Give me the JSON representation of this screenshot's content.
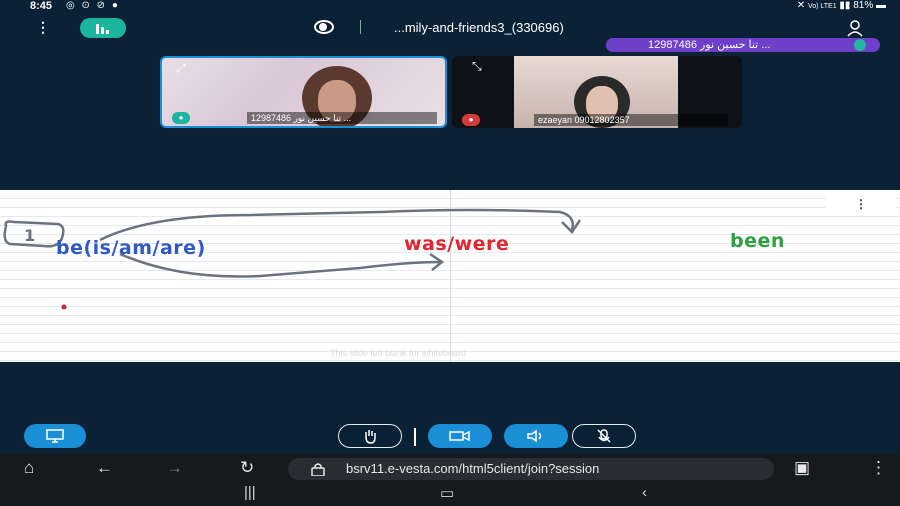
{
  "status": {
    "time": "8:45",
    "left_icons": "◎ ⊙ ⊘ ●",
    "net_label": "Vo)\nLTE1",
    "battery": "81%"
  },
  "header": {
    "meeting_title": "...mily-and-friends3_(330696)"
  },
  "talking": {
    "label": "تنا حسین نور 12987486 ..."
  },
  "videos": [
    {
      "name": "تنا حسین نور 12987486 ...",
      "mic_state": "on"
    },
    {
      "name": "ezaeyan 09012802357",
      "mic_state": "muted"
    }
  ],
  "whiteboard": {
    "number": "1",
    "word1": "be(is/am/are)",
    "word2": "was/were",
    "word3": "been",
    "blank_note": "This slide left blank for whiteboard",
    "menu_icon": "⋮"
  },
  "browser": {
    "url": "bsrv11.e-vesta.com/html5client/join?session"
  },
  "colors": {
    "bg": "#0b2236",
    "accent_teal": "#19b59f",
    "accent_blue": "#1a8fd6",
    "talk_pill": "#6e3fc9",
    "word_blue": "#2f58c9",
    "word_red": "#e0262e",
    "word_green": "#2ea043"
  },
  "icons": [
    "home-icon",
    "back-icon",
    "forward-icon",
    "reload-icon",
    "lock-icon",
    "tabs-icon",
    "menu-icon",
    "recents-icon",
    "home-nav-icon",
    "back-nav-icon",
    "hand-icon",
    "camera-icon",
    "speaker-icon",
    "mic-off-icon",
    "screen-share-icon"
  ]
}
